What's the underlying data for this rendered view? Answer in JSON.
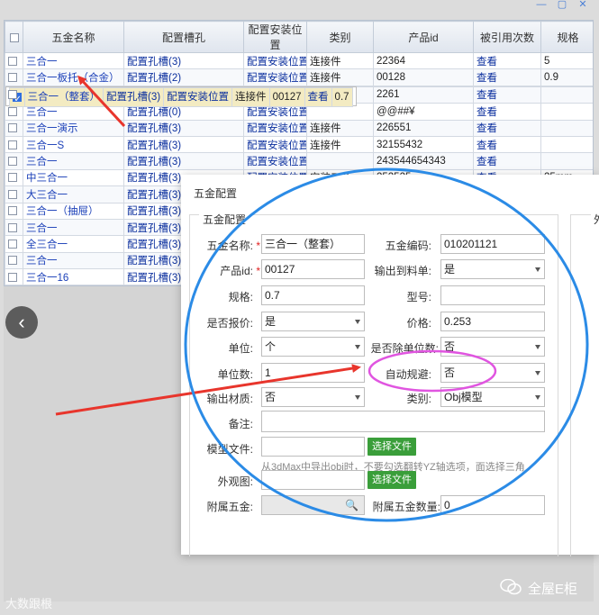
{
  "window": {
    "title": "",
    "min": "—",
    "max": "▢",
    "close": "✕"
  },
  "grid": {
    "columns": [
      "",
      "五金名称",
      "配置槽孔",
      "配置安装位置",
      "类别",
      "产品id",
      "被引用次数",
      "规格"
    ],
    "rows": [
      {
        "checked": false,
        "name": "三合一",
        "slot": "配置孔槽(3)",
        "pos": "配置安装位置",
        "cat": "连接件",
        "pid": "22364",
        "ref": "查看",
        "spec": "5"
      },
      {
        "checked": false,
        "name": "三合一板托（合金）",
        "slot": "配置孔槽(2)",
        "pos": "配置安装位置",
        "cat": "连接件",
        "pid": "00128",
        "ref": "查看",
        "spec": "0.9"
      },
      {
        "checked": true,
        "name": "三合一（整套）",
        "slot": "配置孔槽(3)",
        "pos": "配置安装位置",
        "cat": "连接件",
        "pid": "00127",
        "ref": "查看",
        "spec": "0.7"
      },
      {
        "checked": false,
        "name": "三合一演示",
        "slot": "配置孔槽(3)",
        "pos": "配置安装位置",
        "cat": "连接件",
        "pid": "2261",
        "ref": "查看",
        "spec": ""
      },
      {
        "checked": false,
        "name": "三合一",
        "slot": "配置孔槽(0)",
        "pos": "配置安装位置",
        "cat": "",
        "pid": "@@##¥",
        "ref": "查看",
        "spec": ""
      },
      {
        "checked": false,
        "name": "三合一演示",
        "slot": "配置孔槽(3)",
        "pos": "配置安装位置",
        "cat": "连接件",
        "pid": "226551",
        "ref": "查看",
        "spec": ""
      },
      {
        "checked": false,
        "name": "三合一S",
        "slot": "配置孔槽(3)",
        "pos": "配置安装位置",
        "cat": "连接件",
        "pid": "32155432",
        "ref": "查看",
        "spec": ""
      },
      {
        "checked": false,
        "name": "三合一",
        "slot": "配置孔槽(3)",
        "pos": "配置安装位置",
        "cat": "",
        "pid": "243544654343",
        "ref": "查看",
        "spec": ""
      },
      {
        "checked": false,
        "name": "中三合一",
        "slot": "配置孔槽(3)",
        "pos": "配置安装位置",
        "cat": "安装五金",
        "pid": "252525",
        "ref": "查看",
        "spec": "25mm"
      },
      {
        "checked": false,
        "name": "大三合一",
        "slot": "配置孔槽(3)",
        "pos": "",
        "cat": "",
        "pid": "",
        "ref": "",
        "spec": ""
      },
      {
        "checked": false,
        "name": "三合一（抽屉）",
        "slot": "配置孔槽(3)",
        "pos": "",
        "cat": "",
        "pid": "",
        "ref": "",
        "spec": ""
      },
      {
        "checked": false,
        "name": "三合一",
        "slot": "配置孔槽(3)",
        "pos": "",
        "cat": "",
        "pid": "",
        "ref": "",
        "spec": ""
      },
      {
        "checked": false,
        "name": "全三合一",
        "slot": "配置孔槽(3)",
        "pos": "",
        "cat": "",
        "pid": "",
        "ref": "",
        "spec": ""
      },
      {
        "checked": false,
        "name": "三合一",
        "slot": "配置孔槽(3)",
        "pos": "",
        "cat": "",
        "pid": "",
        "ref": "",
        "spec": ""
      },
      {
        "checked": false,
        "name": "三合一16",
        "slot": "配置孔槽(3)",
        "pos": "",
        "cat": "",
        "pid": "",
        "ref": "",
        "spec": ""
      }
    ]
  },
  "nav": {
    "prev": "‹"
  },
  "dialog": {
    "title": "五金配置",
    "section_title": "五金配置",
    "side_section_title": "外",
    "fields": {
      "name_label": "五金名称:",
      "name_value": "三合一（整套）",
      "code_label": "五金编码:",
      "code_value": "010201121",
      "pid_label": "产品id:",
      "pid_value": "00127",
      "export_label": "输出到料单:",
      "export_value": "是",
      "spec_label": "规格:",
      "spec_value": "0.7",
      "model_label": "型号:",
      "model_value": "",
      "quote_label": "是否报价:",
      "quote_value": "是",
      "price_label": "价格:",
      "price_value": "0.253",
      "unit_label": "单位:",
      "unit_value": "个",
      "divide_label": "是否除单位数:",
      "divide_value": "否",
      "unitnum_label": "单位数:",
      "unitnum_value": "1",
      "auto_avoid_label": "自动规避:",
      "auto_avoid_value": "否",
      "material_label": "输出材质:",
      "material_value": "否",
      "category_label": "类别:",
      "category_value": "Obj模型",
      "remark_label": "备注:",
      "remark_value": "",
      "modelfile_label": "模型文件:",
      "modelfile_button": "选择文件",
      "modelfile_hint": "从3dMax中导出obj时，不要勾选翻转YZ轴选项，面选择三角",
      "appearance_label": "外观图:",
      "appearance_button": "选择文件",
      "attached_label": "附属五金:",
      "attached_qty_label": "附属五金数量:",
      "attached_qty_value": "0"
    }
  },
  "watermarks": {
    "left": "大数跟根",
    "right": "全屋E柜"
  },
  "colors": {
    "arrow_red": "#e8352c",
    "circle_blue": "#2b8be6",
    "ellipse_pink": "#e055e0",
    "accent_link": "#1a3fb8"
  }
}
